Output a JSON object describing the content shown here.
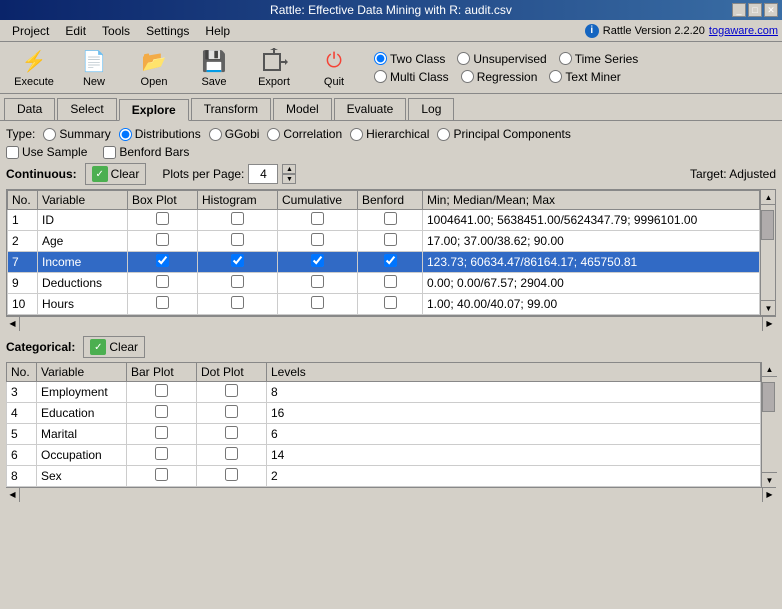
{
  "window": {
    "title": "Rattle: Effective Data Mining with R: audit.csv"
  },
  "title_controls": {
    "minimize": "_",
    "maximize": "□",
    "close": "✕"
  },
  "menu": {
    "items": [
      "Project",
      "Edit",
      "Tools",
      "Settings",
      "Help"
    ],
    "rattle_version": "Rattle Version 2.2.20",
    "togaware": "togaware.com"
  },
  "toolbar": {
    "execute_label": "Execute",
    "new_label": "New",
    "open_label": "Open",
    "save_label": "Save",
    "export_label": "Export",
    "quit_label": "Quit"
  },
  "radio_options": {
    "two_class": "Two Class",
    "unsupervised": "Unsupervised",
    "time_series": "Time Series",
    "multi_class": "Multi Class",
    "regression": "Regression",
    "text_miner": "Text Miner"
  },
  "tabs": [
    "Data",
    "Select",
    "Explore",
    "Transform",
    "Model",
    "Evaluate",
    "Log"
  ],
  "active_tab": "Explore",
  "type_label": "Type:",
  "type_options": [
    "Summary",
    "Distributions",
    "GGobi",
    "Correlation",
    "Hierarchical",
    "Principal Components"
  ],
  "active_type": "Distributions",
  "checks": {
    "use_sample": "Use Sample",
    "benford_bars": "Benford Bars"
  },
  "continuous": {
    "label": "Continuous:",
    "clear_label": "Clear",
    "plots_per_page_label": "Plots per Page:",
    "plots_per_page_value": "4",
    "target_label": "Target: Adjusted"
  },
  "cont_columns": [
    "No.",
    "Variable",
    "Box Plot",
    "Histogram",
    "Cumulative",
    "Benford",
    "Min; Median/Mean; Max"
  ],
  "cont_rows": [
    {
      "no": "1",
      "variable": "ID",
      "box_plot": false,
      "histogram": false,
      "cumulative": false,
      "benford": false,
      "stats": "1004641.00; 5638451.00/5624347.79; 9996101.00",
      "selected": false
    },
    {
      "no": "2",
      "variable": "Age",
      "box_plot": false,
      "histogram": false,
      "cumulative": false,
      "benford": false,
      "stats": "17.00; 37.00/38.62; 90.00",
      "selected": false
    },
    {
      "no": "7",
      "variable": "Income",
      "box_plot": true,
      "histogram": true,
      "cumulative": true,
      "benford": true,
      "stats": "123.73; 60634.47/86164.17; 465750.81",
      "selected": true
    },
    {
      "no": "9",
      "variable": "Deductions",
      "box_plot": false,
      "histogram": false,
      "cumulative": false,
      "benford": false,
      "stats": "0.00; 0.00/67.57; 2904.00",
      "selected": false
    },
    {
      "no": "10",
      "variable": "Hours",
      "box_plot": false,
      "histogram": false,
      "cumulative": false,
      "benford": false,
      "stats": "1.00; 40.00/40.07; 99.00",
      "selected": false
    }
  ],
  "categorical": {
    "label": "Categorical:",
    "clear_label": "Clear"
  },
  "cat_columns": [
    "No.",
    "Variable",
    "Bar Plot",
    "Dot Plot",
    "Levels"
  ],
  "cat_rows": [
    {
      "no": "3",
      "variable": "Employment",
      "bar_plot": false,
      "dot_plot": false,
      "levels": "8"
    },
    {
      "no": "4",
      "variable": "Education",
      "bar_plot": false,
      "dot_plot": false,
      "levels": "16"
    },
    {
      "no": "5",
      "variable": "Marital",
      "bar_plot": false,
      "dot_plot": false,
      "levels": "6"
    },
    {
      "no": "6",
      "variable": "Occupation",
      "bar_plot": false,
      "dot_plot": false,
      "levels": "14"
    },
    {
      "no": "8",
      "variable": "Sex",
      "bar_plot": false,
      "dot_plot": false,
      "levels": "2"
    }
  ]
}
